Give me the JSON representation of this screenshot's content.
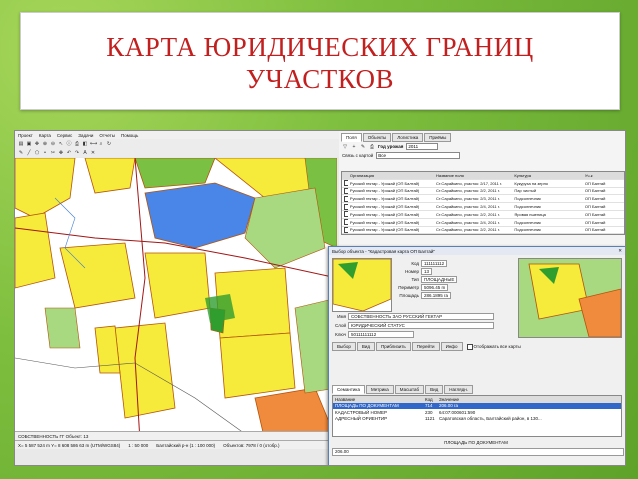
{
  "slide": {
    "title": "КАРТА ЮРИДИЧЕСКИХ ГРАНИЦ\nУЧАСТКОВ",
    "colors": {
      "title": "#c21f1f",
      "background": "#7fbf3f"
    }
  },
  "app": {
    "menu": [
      "Проект",
      "Карта",
      "Сервис",
      "Задачи",
      "Отчеты",
      "Помощь"
    ],
    "status": {
      "object": "СОБСТВЕННОСТЬ ГГ Объект: 13",
      "coords": "X= 5 587 524 m  Y= 8 608 586 63 m (UTM/WGS84)",
      "scale": "1 : 50 000",
      "layer": "Балтайский р-н (1 : 100 000)",
      "total": "Объектов: 7978 / 0 (отобр.)"
    }
  },
  "right_panel": {
    "tabs": [
      "Поля",
      "Объекты",
      "Логистика",
      "Приёмы"
    ],
    "year_label": "Год урожая",
    "year_value": "2011",
    "link_label": "Связь с картой",
    "link_value": "Все",
    "grid": {
      "columns": [
        "",
        "Организация",
        "Название поля",
        "Культура",
        "Уч-к"
      ],
      "rows": [
        [
          "",
          "Русский гектар - Урожай (ОП Балтай)",
          "Ст.Сарайкино, участок: 2/17, 2011 г.",
          "Кукуруза на зерно",
          "ОП Балтай"
        ],
        [
          "",
          "Русский гектар - Урожай (ОП Балтай)",
          "Ст.Сарайкино, участок: 2/2, 2011 г.",
          "Пар чистый",
          "ОП Балтай"
        ],
        [
          "",
          "Русский гектар - Урожай (ОП Балтай)",
          "Ст.Сарайкино, участок: 2/3, 2011 г.",
          "Подсолнечник",
          "ОП Балтай"
        ],
        [
          "",
          "Русский гектар - Урожай (ОП Балтай)",
          "Ст.Сарайкино, участок: 2/4, 2011 г.",
          "Подсолнечник",
          "ОП Балтай"
        ],
        [
          "",
          "Русский гектар - Урожай (ОП Балтай)",
          "Ст.Сарайкино, участок: 2/2, 2011 г.",
          "Яровая пшеница",
          "ОП Балтай"
        ],
        [
          "",
          "Русский гектар - Урожай (ОП Балтай)",
          "Ст.Сарайкино, участок: 2/4, 2011 г.",
          "Подсолнечник",
          "ОП Балтай"
        ],
        [
          "",
          "Русский гектар - Урожай (ОП Балтай)",
          "Ст.Сарайкино, участок: 2/2, 2011 г.",
          "Подсолнечник",
          "ОП Балтай"
        ]
      ]
    }
  },
  "dialog": {
    "title": "Выбор объекта - \"Кадастровая карта ОП Балтай\"",
    "fields": {
      "code": {
        "label": "Код",
        "value": "111111112"
      },
      "number": {
        "label": "Номер",
        "value": "13"
      },
      "type": {
        "label": "Тип",
        "value": "ПЛОЩАДНЫЕ"
      },
      "perimeter": {
        "label": "Периметр",
        "value": "5096.45 m"
      },
      "area": {
        "label": "Площадь",
        "value": "286.1895 га"
      },
      "name": {
        "label": "Имя",
        "value": "СОБСТВЕННОСТЬ ЗАО РУССКИЙ ГЕКТАР"
      },
      "layer": {
        "label": "Слой",
        "value": "ЮРИДИЧЕСКИЙ СТАТУС"
      },
      "key": {
        "label": "Ключ",
        "value": "50111111112"
      }
    },
    "buttons": [
      "Выбор",
      "Вид",
      "Приблизить",
      "Перейти",
      "Инфо"
    ],
    "show_all_label": "Отображать все карты",
    "tabs": [
      "Семантика",
      "Метрика",
      "Масштаб",
      "Вид",
      "Наглядн."
    ],
    "list_headers": [
      "Название",
      "Код",
      "Значение"
    ],
    "list_rows": [
      {
        "name": "ПЛОЩАДЬ ПО ДОКУМЕНТАМ",
        "code": "714",
        "value": "206.00 га",
        "selected": true
      },
      {
        "name": "КАДАСТРОВЫЙ НОМЕР",
        "code": "230",
        "value": "64:07:000601:590",
        "selected": false
      },
      {
        "name": "АДРЕСНЫЙ ОРИЕНТИР",
        "code": "1121",
        "value": "Саратовская область, Балтайский район, в 130...",
        "selected": false
      }
    ],
    "footer_label": "ПЛОЩАДЬ ПО ДОКУМЕНТАМ",
    "footer_value": "206.00"
  }
}
